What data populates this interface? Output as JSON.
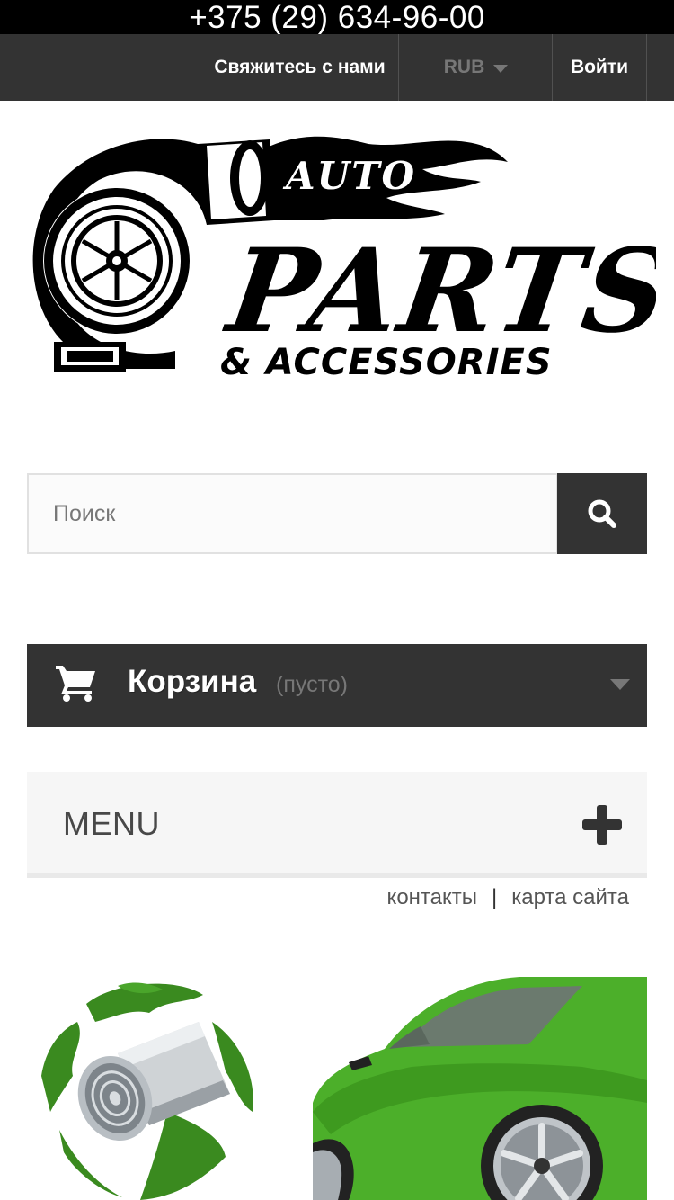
{
  "top_bar": {
    "phone": "+375 (29) 634-96-00"
  },
  "nav": {
    "contact_label": "Свяжитесь с нами",
    "currency_label": "RUB",
    "login_label": "Войти"
  },
  "logo": {
    "word1": "AUTO",
    "word2": "PARTS",
    "word3": "& ACCESSORIES"
  },
  "search": {
    "placeholder": "Поиск",
    "value": ""
  },
  "cart": {
    "title": "Корзина",
    "status": "(пусто)"
  },
  "menu": {
    "label": "MENU"
  },
  "footer_links": {
    "contacts": "контакты",
    "separator": "|",
    "sitemap": "карта сайта"
  },
  "colors": {
    "dark": "#333333",
    "black": "#000000",
    "muted": "#777777",
    "light_bg": "#f6f6f6",
    "leaf_green": "#3a8a1f"
  }
}
